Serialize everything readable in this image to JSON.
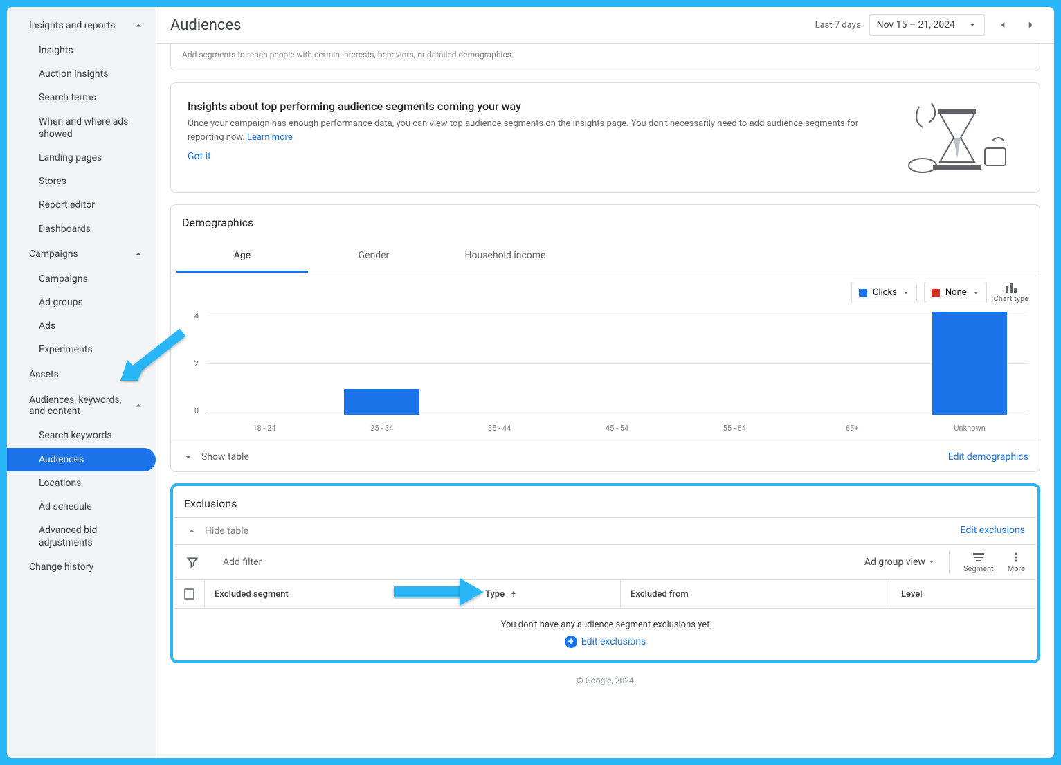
{
  "page_title": "Audiences",
  "date_range_label": "Last 7 days",
  "date_range_value": "Nov 15 – 21, 2024",
  "sidebar": {
    "sections": [
      {
        "label": "Insights and reports",
        "items": [
          {
            "label": "Insights"
          },
          {
            "label": "Auction insights"
          },
          {
            "label": "Search terms"
          },
          {
            "label": "When and where ads showed"
          },
          {
            "label": "Landing pages"
          },
          {
            "label": "Stores"
          },
          {
            "label": "Report editor"
          },
          {
            "label": "Dashboards"
          }
        ]
      },
      {
        "label": "Campaigns",
        "items": [
          {
            "label": "Campaigns"
          },
          {
            "label": "Ad groups"
          },
          {
            "label": "Ads"
          },
          {
            "label": "Experiments"
          }
        ]
      },
      {
        "label": "Assets",
        "items": []
      },
      {
        "label": "Audiences, keywords, and content",
        "items": [
          {
            "label": "Search keywords"
          },
          {
            "label": "Audiences",
            "active": true
          },
          {
            "label": "Locations"
          },
          {
            "label": "Ad schedule"
          },
          {
            "label": "Advanced bid adjustments"
          }
        ]
      }
    ],
    "change_history": "Change history"
  },
  "banner_snippet": "Add segments to reach people with certain interests, behaviors, or detailed demographics",
  "insights_card": {
    "title": "Insights about top performing audience segments coming your way",
    "body": "Once your campaign has enough performance data, you can view top audience segments on the insights page. You don't necessarily need to add audience segments for reporting now. ",
    "learn_more": "Learn more",
    "got_it": "Got it"
  },
  "demographics": {
    "title": "Demographics",
    "tabs": [
      "Age",
      "Gender",
      "Household income"
    ],
    "metric1": "Clicks",
    "metric2": "None",
    "chart_type_label": "Chart type",
    "show_table": "Show table",
    "edit_link": "Edit demographics"
  },
  "chart_data": {
    "type": "bar",
    "categories": [
      "18 - 24",
      "25 - 34",
      "35 - 44",
      "45 - 54",
      "55 - 64",
      "65+",
      "Unknown"
    ],
    "values": [
      0,
      1,
      0,
      0,
      0,
      0,
      4
    ],
    "ylabel": "",
    "ylim": [
      0,
      4
    ],
    "yticks": [
      0,
      2,
      4
    ]
  },
  "exclusions": {
    "title": "Exclusions",
    "hide_table": "Hide table",
    "edit_link": "Edit exclusions",
    "add_filter": "Add filter",
    "view_label": "Ad group view",
    "segment_label": "Segment",
    "more_label": "More",
    "columns": [
      "Excluded segment",
      "Type",
      "Excluded from",
      "Level"
    ],
    "empty_msg": "You don't have any audience segment exclusions yet",
    "empty_action": "Edit exclusions"
  },
  "footer": "© Google, 2024"
}
